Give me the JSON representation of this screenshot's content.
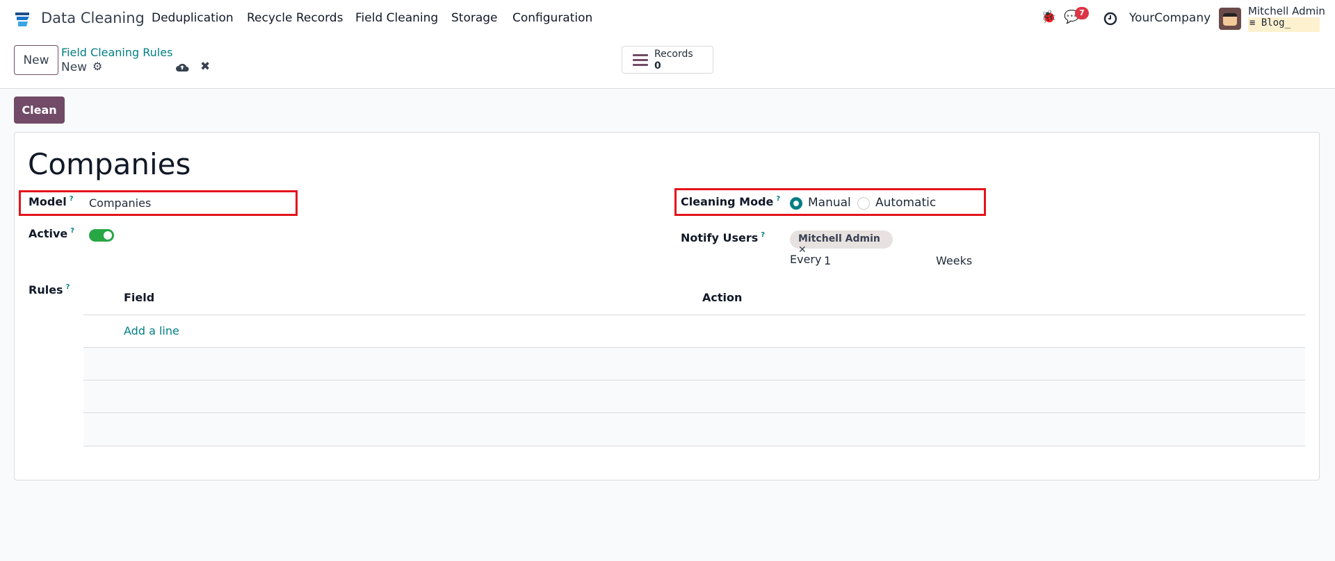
{
  "app": {
    "title": "Data Cleaning",
    "menu": [
      "Deduplication",
      "Recycle Records",
      "Field Cleaning",
      "Storage",
      "Configuration"
    ]
  },
  "systray": {
    "message_count": "7",
    "company": "YourCompany",
    "user": "Mitchell Admin",
    "database": "Blog_"
  },
  "control_panel": {
    "new_label": "New",
    "breadcrumb_parent": "Field Cleaning Rules",
    "breadcrumb_current": "New",
    "records_label": "Records",
    "records_count": "0"
  },
  "actions": {
    "clean_label": "Clean"
  },
  "form": {
    "title": "Companies",
    "model_label": "Model",
    "model_value": "Companies",
    "active_label": "Active",
    "active": true,
    "cleaning_mode_label": "Cleaning Mode",
    "mode_options": [
      "Manual",
      "Automatic"
    ],
    "mode_selected": "Manual",
    "notify_label": "Notify Users",
    "notify_users": [
      "Mitchell Admin"
    ],
    "every_label": "Every",
    "every_value": "1",
    "every_unit": "Weeks",
    "rules_label": "Rules",
    "rules_columns": [
      "Field",
      "Action"
    ],
    "add_line": "Add a line",
    "help_mark": "?"
  },
  "colors": {
    "primary": "#714b67",
    "link": "#017e84",
    "highlight": "#e3141b",
    "toggle": "#28a745"
  }
}
